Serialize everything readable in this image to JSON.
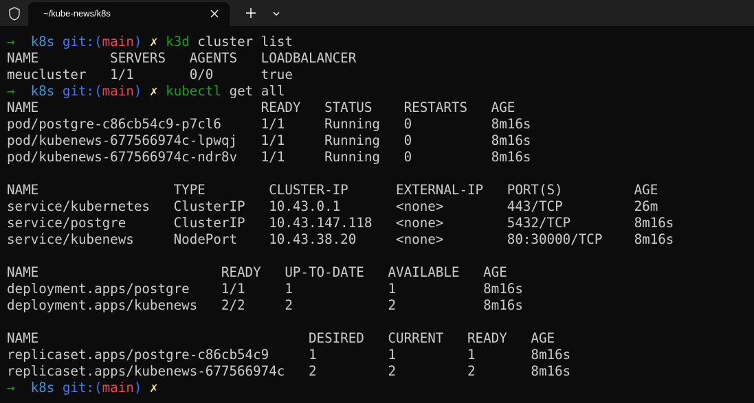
{
  "tab": {
    "title": "~/kube-news/k8s"
  },
  "prompt": {
    "arrow": "→",
    "dir": "k8s",
    "git_label": "git:",
    "paren_open": "(",
    "branch": "main",
    "paren_close": ")",
    "dirty_mark": "✗"
  },
  "commands": [
    {
      "program": "k3d",
      "args": " cluster list"
    },
    {
      "program": "kubectl",
      "args": " get all"
    }
  ],
  "output": {
    "clusters": [
      "NAME         SERVERS   AGENTS   LOADBALANCER",
      "meucluster   1/1       0/0      true"
    ],
    "pods": [
      "NAME                            READY   STATUS    RESTARTS   AGE",
      "pod/postgre-c86cb54c9-p7cl6     1/1     Running   0          8m16s",
      "pod/kubenews-677566974c-lpwqj   1/1     Running   0          8m16s",
      "pod/kubenews-677566974c-ndr8v   1/1     Running   0          8m16s"
    ],
    "services": [
      "NAME                 TYPE        CLUSTER-IP      EXTERNAL-IP   PORT(S)         AGE",
      "service/kubernetes   ClusterIP   10.43.0.1       <none>        443/TCP         26m",
      "service/postgre      ClusterIP   10.43.147.118   <none>        5432/TCP        8m16s",
      "service/kubenews     NodePort    10.43.38.20     <none>        80:30000/TCP    8m16s"
    ],
    "deployments": [
      "NAME                       READY   UP-TO-DATE   AVAILABLE   AGE",
      "deployment.apps/postgre    1/1     1            1           8m16s",
      "deployment.apps/kubenews   2/2     2            2           8m16s"
    ],
    "replicasets": [
      "NAME                                  DESIRED   CURRENT   READY   AGE",
      "replicaset.apps/postgre-c86cb54c9     1         1         1       8m16s",
      "replicaset.apps/kubenews-677566974c   2         2         2       8m16s"
    ]
  },
  "icons": {
    "shield": "shield-icon",
    "close": "close-icon",
    "new_tab": "plus-icon",
    "dropdown": "chevron-down-icon"
  },
  "colors": {
    "background": "#0c0c0c",
    "titlebar": "#202020",
    "prompt_arrow": "#13a10e",
    "dir": "#3a96dd",
    "git_label": "#3b78ff",
    "branch": "#e74856",
    "dirty_mark": "#f9f1a5",
    "command": "#13a10e",
    "text": "#cccccc"
  }
}
